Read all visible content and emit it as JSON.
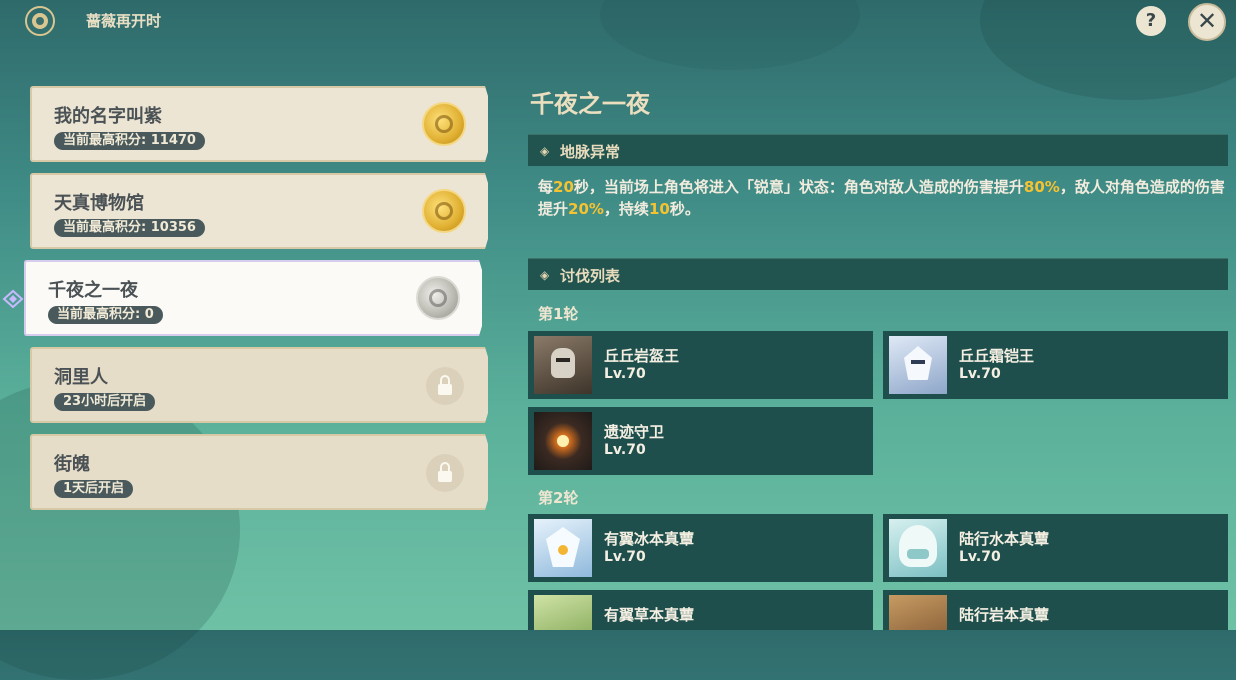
{
  "header": {
    "title": "蔷薇再开时",
    "help_label": "?",
    "close_label": "✕"
  },
  "challenges": [
    {
      "name": "我的名字叫紫",
      "status": "当前最高积分: 11470",
      "reward": "gold-medal"
    },
    {
      "name": "天真博物馆",
      "status": "当前最高积分: 10356",
      "reward": "gold-medal"
    },
    {
      "name": "千夜之一夜",
      "status": "当前最高积分: 0",
      "reward": "silver-medal",
      "selected": true
    },
    {
      "name": "洞里人",
      "status": "23小时后开启",
      "reward": "lock-icon"
    },
    {
      "name": "街魄",
      "status": "1天后开启",
      "reward": "lock-icon"
    }
  ],
  "detail": {
    "title": "千夜之一夜",
    "leyline": {
      "header": "地脉异常",
      "p1": "每",
      "v1": "20",
      "p2": "秒，当前场上角色将进入「锐意」状态：角色对敌人造成的伤害提升",
      "v2": "80%",
      "p3": "，敌人对角色造成的伤害提升",
      "v3": "20%",
      "p4": "，持续",
      "v4": "10",
      "p5": "秒。"
    },
    "enemy_list_header": "讨伐列表",
    "rounds": [
      {
        "label": "第1轮",
        "enemies": [
          {
            "name": "丘丘岩盔王",
            "level": "Lv.70"
          },
          {
            "name": "丘丘霜铠王",
            "level": "Lv.70"
          },
          {
            "name": "遗迹守卫",
            "level": "Lv.70"
          }
        ]
      },
      {
        "label": "第2轮",
        "enemies": [
          {
            "name": "有翼冰本真蕈",
            "level": "Lv.70"
          },
          {
            "name": "陆行水本真蕈",
            "level": "Lv.70"
          },
          {
            "name": "有翼草本真蕈",
            "level": ""
          },
          {
            "name": "陆行岩本真蕈",
            "level": ""
          }
        ]
      }
    ]
  },
  "colors": {
    "accent": "#f5c231",
    "panel": "#1f4f4c",
    "card": "#ede5d3"
  }
}
